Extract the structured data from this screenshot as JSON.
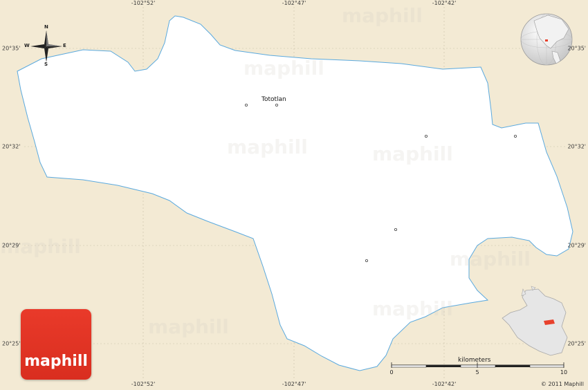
{
  "map": {
    "place_label": "Tototlan",
    "coords_top": [
      "-102°52'",
      "-102°47'",
      "-102°42'"
    ],
    "coords_bottom": [
      "-102°52'",
      "-102°47'",
      "-102°42'"
    ],
    "coords_left": [
      "20°35'",
      "20°32'",
      "20°29'",
      "20°25'"
    ],
    "coords_right": [
      "20°35'",
      "20°32'",
      "20°29'",
      "20°25'"
    ],
    "watermark_text": "maphill",
    "compass": {
      "n": "N",
      "s": "S",
      "e": "E",
      "w": "W"
    },
    "scale": {
      "label": "kilometers",
      "ticks": [
        "0",
        "5",
        "10"
      ]
    },
    "logo_text": "maphill",
    "copyright": "© 2011 Maphill",
    "colors": {
      "background": "#f3ead4",
      "region_fill": "#ffffff",
      "border": "#5aa9de",
      "logo": "#e4362a",
      "highlight": "#e8412c"
    }
  }
}
